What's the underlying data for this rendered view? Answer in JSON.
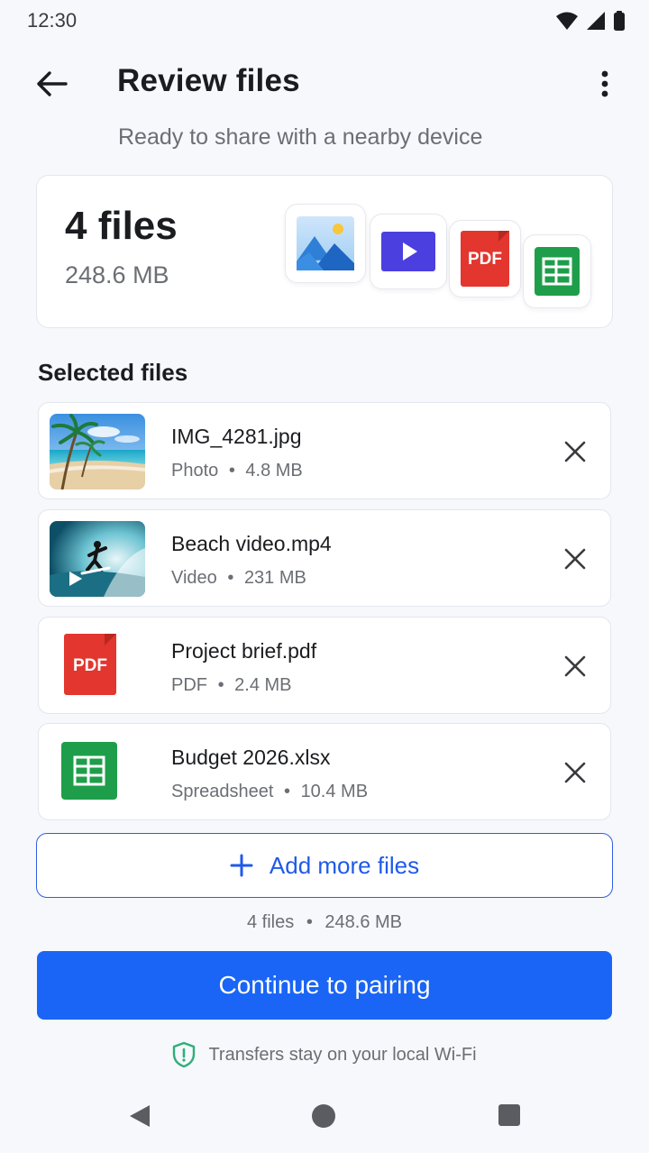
{
  "status": {
    "time": "12:30",
    "icons": [
      "wifi-icon",
      "signal-icon",
      "battery-icon"
    ]
  },
  "app_bar": {
    "title": "Review files",
    "subtitle": "Ready to share with a nearby device"
  },
  "summary": {
    "count": "4 files",
    "size": "248.6 MB",
    "tiles": [
      {
        "icon": "image-icon"
      },
      {
        "icon": "video-icon"
      },
      {
        "icon": "pdf-icon",
        "label": "PDF"
      },
      {
        "icon": "spreadsheet-icon"
      }
    ]
  },
  "section_title": "Selected files",
  "files": [
    {
      "name": "IMG_4281.jpg",
      "type": "Photo",
      "size": "4.8 MB",
      "thumb": "beach-photo"
    },
    {
      "name": "Beach video.mp4",
      "type": "Video",
      "size": "231 MB",
      "thumb": "surf-video"
    },
    {
      "name": "Project brief.pdf",
      "type": "PDF",
      "size": "2.4 MB",
      "thumb": "pdf-icon",
      "thumb_label": "PDF"
    },
    {
      "name": "Budget 2026.xlsx",
      "type": "Spreadsheet",
      "size": "10.4 MB",
      "thumb": "spreadsheet-icon"
    }
  ],
  "meta_separator": "•",
  "add_more_label": "Add more files",
  "totals": {
    "count": "4 files",
    "size": "248.6 MB"
  },
  "continue_label": "Continue to pairing",
  "security_note": "Transfers stay on your local Wi-Fi",
  "colors": {
    "accent": "#1a65f5",
    "pdf_red": "#e2362f",
    "sheet_green": "#1e9e4a",
    "video_indigo": "#4b3fe0",
    "shield_green": "#2fae7a"
  }
}
